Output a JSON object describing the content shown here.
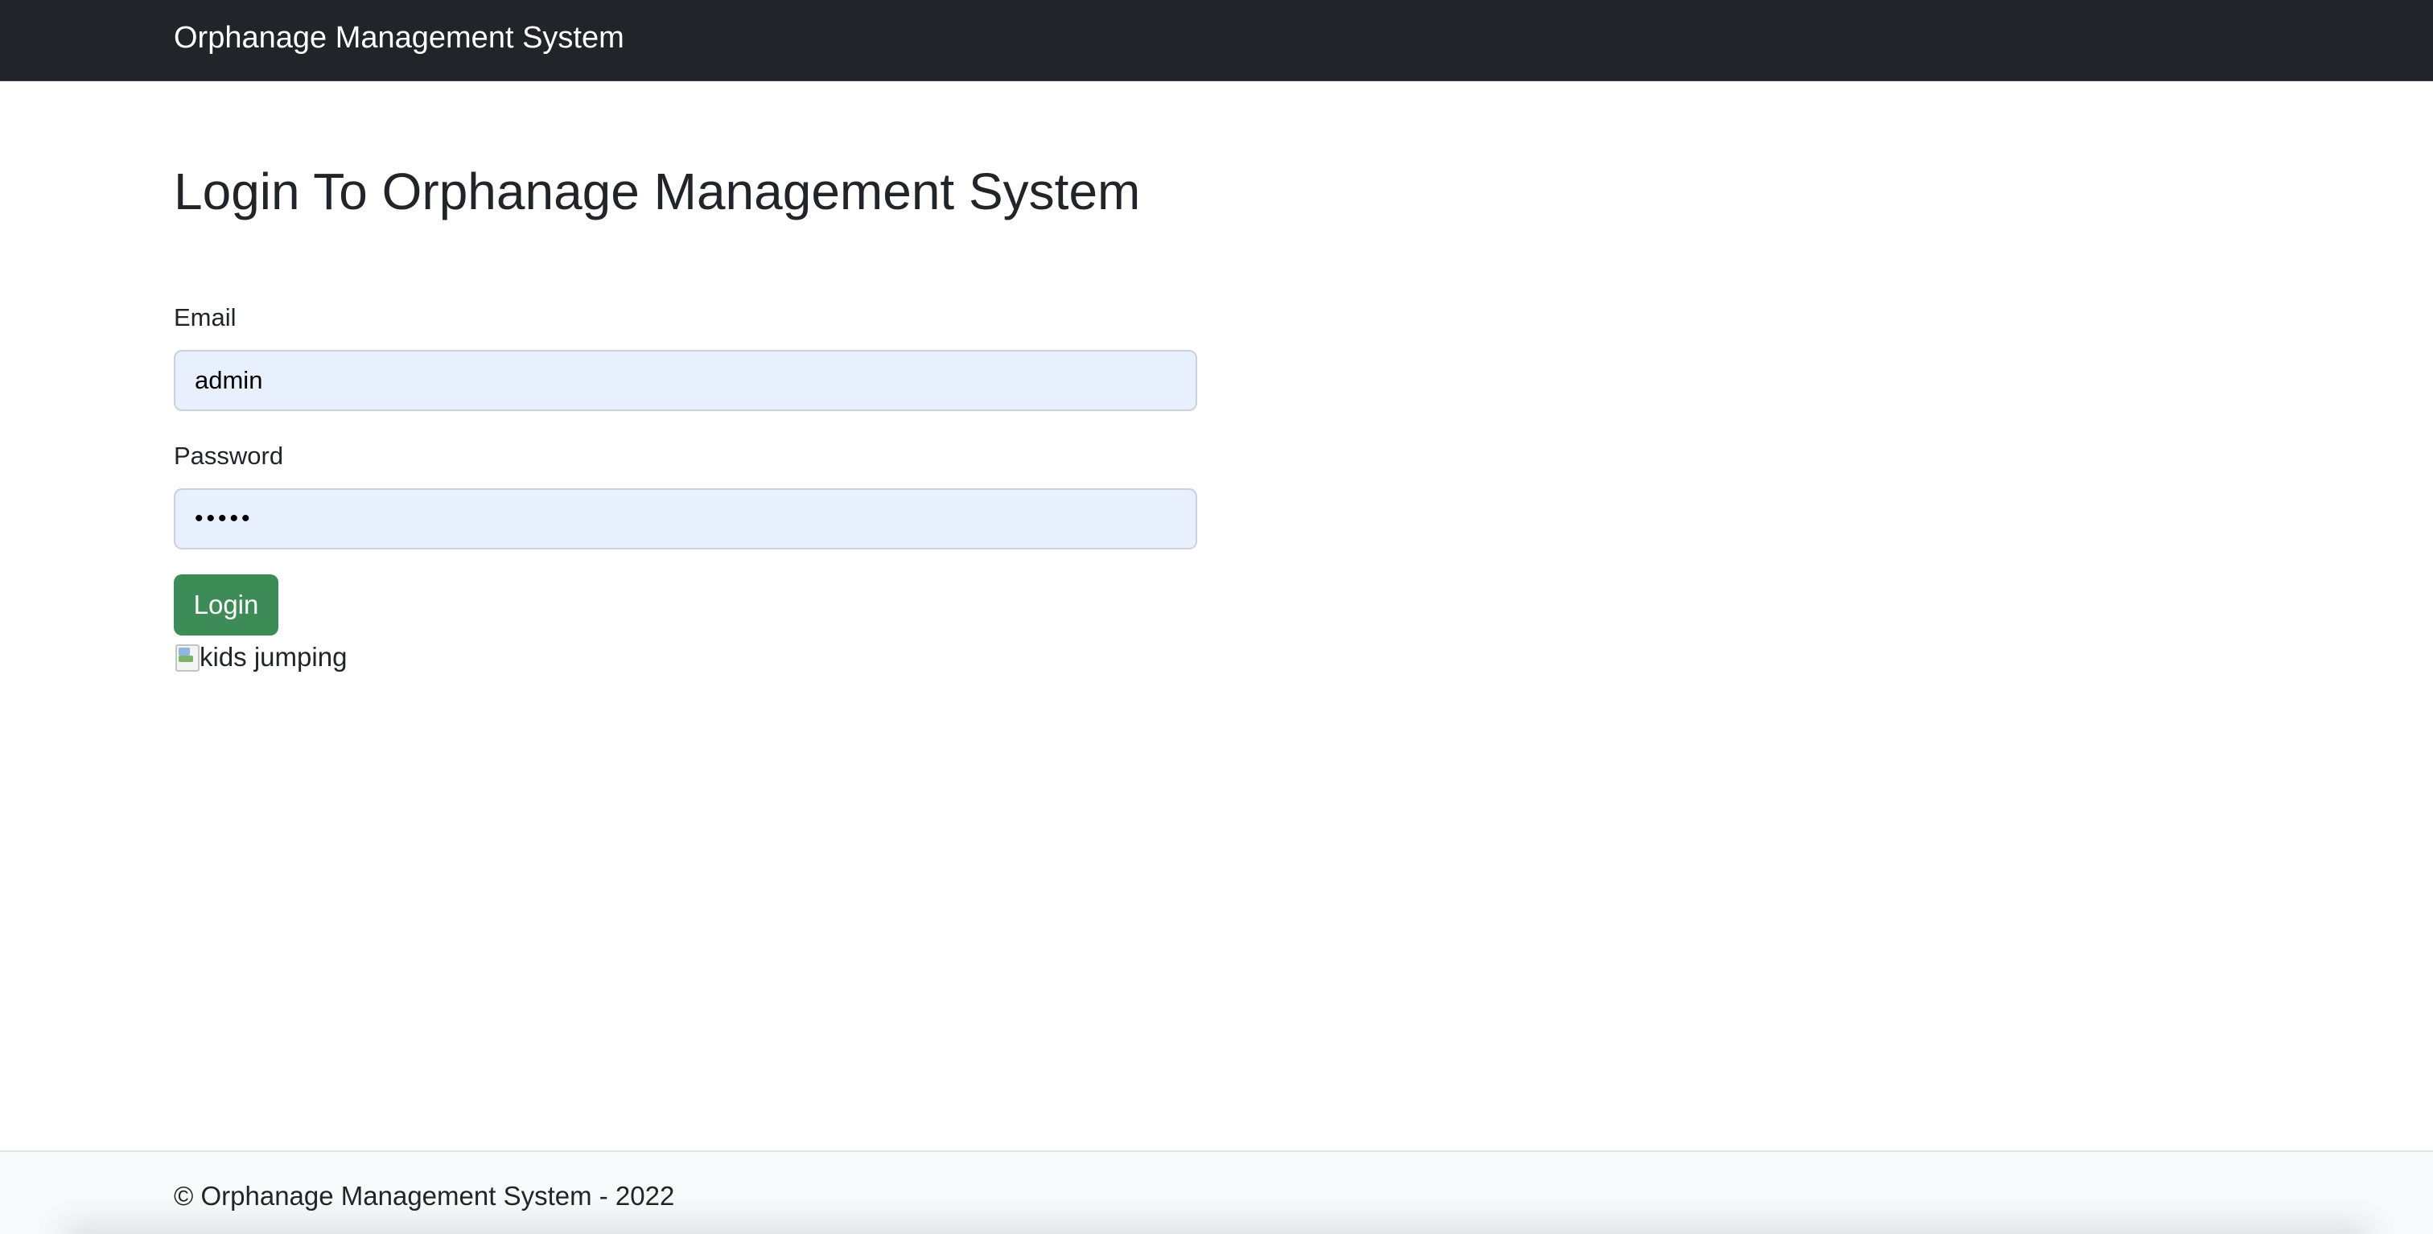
{
  "navbar": {
    "brand": "Orphanage Management System"
  },
  "login": {
    "title": "Login To Orphanage Management System",
    "email_label": "Email",
    "email_value": "admin",
    "password_label": "Password",
    "password_display": "•••••",
    "submit_label": "Login"
  },
  "image": {
    "alt": "kids jumping",
    "icon": "broken-image-icon"
  },
  "footer": {
    "text": "© Orphanage Management System - 2022"
  },
  "colors": {
    "navbar_bg": "#212529",
    "input_bg": "#e8f0fe",
    "button_bg": "#3d8b57",
    "footer_bg": "#f8f9fa"
  }
}
